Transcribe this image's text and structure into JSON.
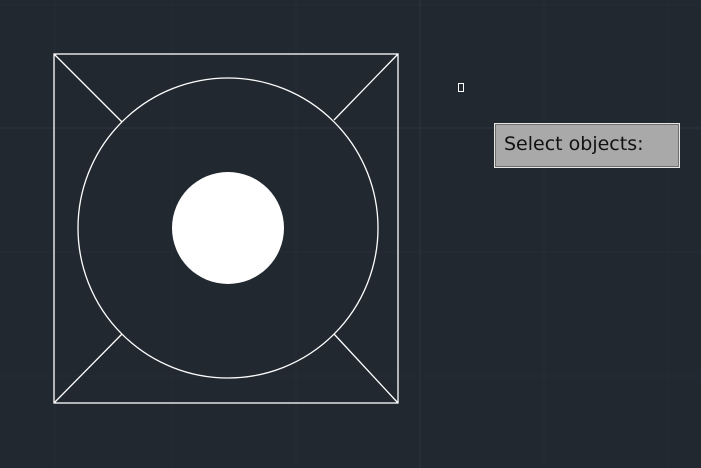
{
  "viewport": {
    "background": "#212830",
    "grid_major_color": "#2d3440",
    "grid_minor_color": "#262d37",
    "geometry_color": "#ffffff"
  },
  "drawing": {
    "objects": [
      "outer-square",
      "outer-circle",
      "filled-inner-circle",
      "corner-diagonals"
    ]
  },
  "cursor": {
    "type": "pickbox"
  },
  "tooltip": {
    "text": "Select objects:",
    "background": "#a9a9a9"
  }
}
